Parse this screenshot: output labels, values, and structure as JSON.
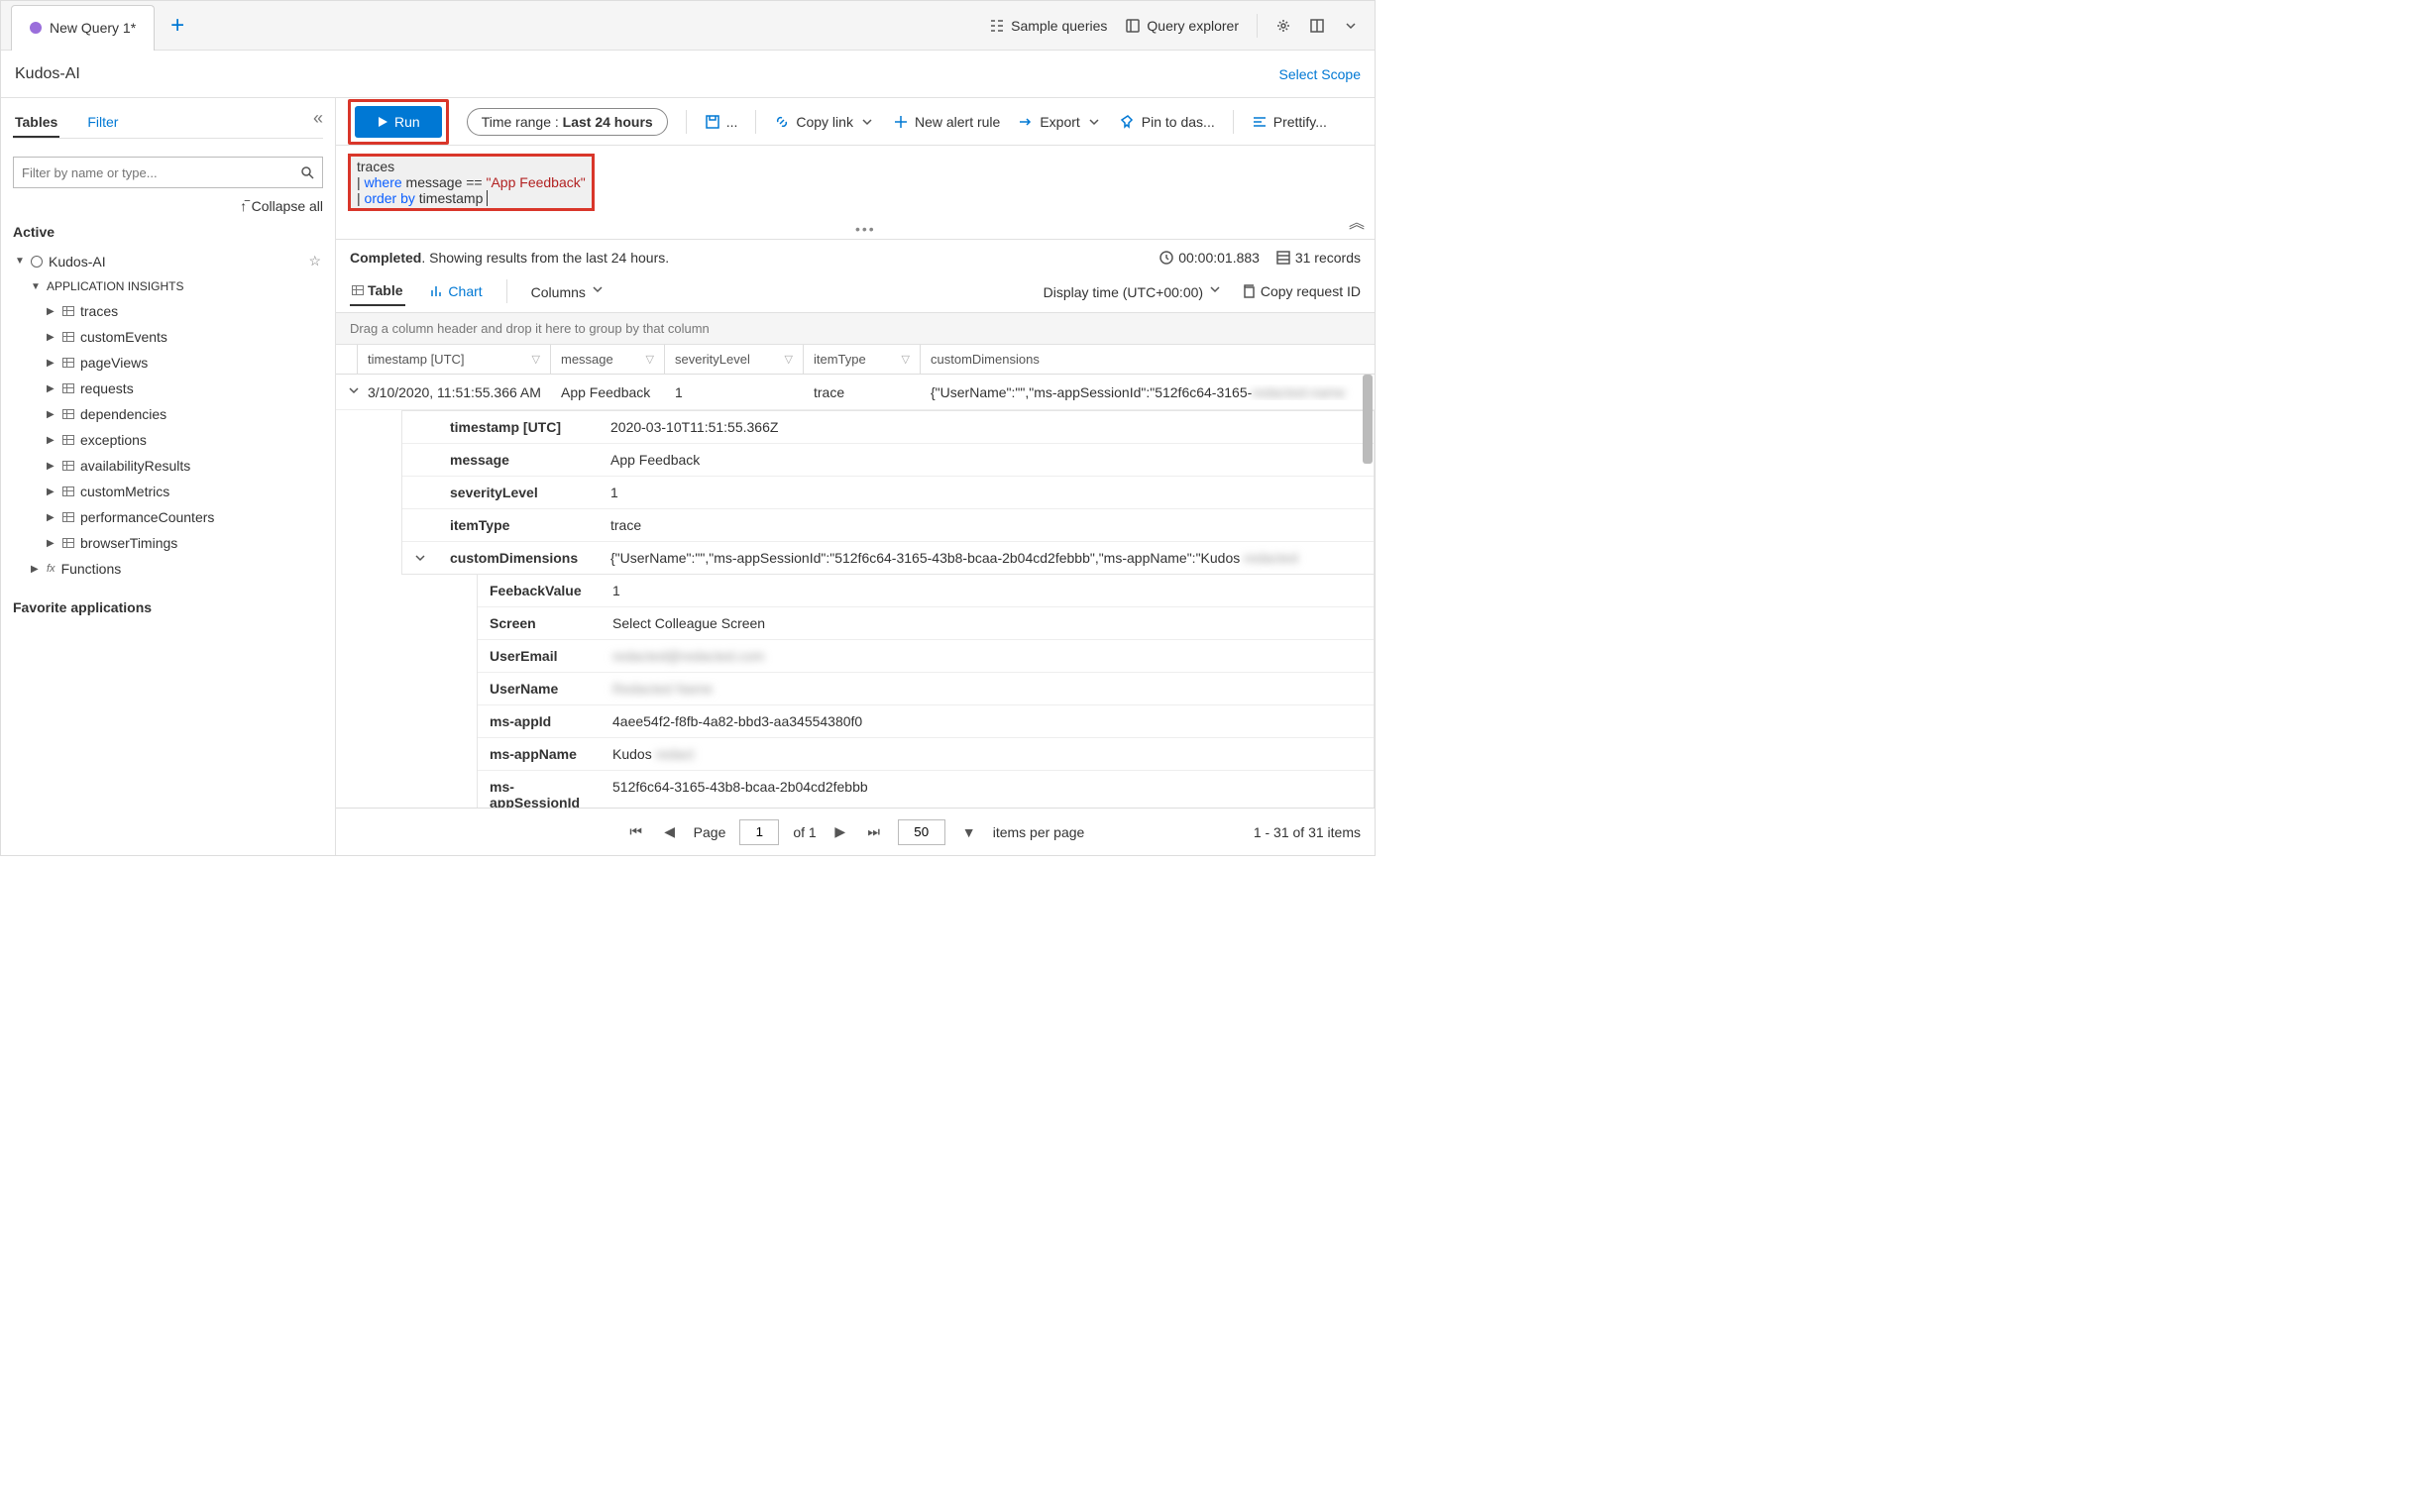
{
  "tab": {
    "title": "New Query 1*"
  },
  "topbar": {
    "sample_queries": "Sample queries",
    "query_explorer": "Query explorer"
  },
  "scope": {
    "name": "Kudos-AI",
    "select_scope": "Select Scope"
  },
  "sidebar": {
    "tabs": {
      "tables": "Tables",
      "filter": "Filter"
    },
    "search_placeholder": "Filter by name or type...",
    "collapse_all": "Collapse all",
    "active_heading": "Active",
    "root": "Kudos-AI",
    "group": "APPLICATION INSIGHTS",
    "items": [
      "traces",
      "customEvents",
      "pageViews",
      "requests",
      "dependencies",
      "exceptions",
      "availabilityResults",
      "customMetrics",
      "performanceCounters",
      "browserTimings"
    ],
    "functions": "Functions",
    "favorites_heading": "Favorite applications"
  },
  "toolbar": {
    "run": "Run",
    "time_range_prefix": "Time range : ",
    "time_range_value": "Last 24 hours",
    "save_more": "...",
    "copy_link": "Copy link",
    "new_alert": "New alert rule",
    "export": "Export",
    "pin": "Pin to das...",
    "prettify": "Prettify..."
  },
  "query": {
    "line1": "traces",
    "line2_pipe": "| ",
    "line2_kw": "where",
    "line2_field": " message == ",
    "line2_str": "\"App Feedback\"",
    "line3_pipe": "| ",
    "line3_kw": "order by",
    "line3_field": " timestamp"
  },
  "status": {
    "completed": "Completed",
    "showing": ". Showing results from the last 24 hours.",
    "elapsed": "00:00:01.883",
    "records": "31 records"
  },
  "views": {
    "table": "Table",
    "chart": "Chart",
    "columns": "Columns",
    "display_time": "Display time (UTC+00:00)",
    "copy_request": "Copy request ID"
  },
  "group_hint": "Drag a column header and drop it here to group by that column",
  "columns": {
    "timestamp": "timestamp [UTC]",
    "message": "message",
    "severity": "severityLevel",
    "itemType": "itemType",
    "customDimensions": "customDimensions"
  },
  "row": {
    "timestamp_display": "3/10/2020, 11:51:55.366 AM",
    "message": "App Feedback",
    "severity": "1",
    "itemType": "trace",
    "customDimensions_preview": "{\"UserName\":\"\",\"ms-appSessionId\":\"512f6c64-3165-"
  },
  "details": {
    "timestamp_key": "timestamp [UTC]",
    "timestamp_val": "2020-03-10T11:51:55.366Z",
    "message_key": "message",
    "message_val": "App Feedback",
    "severity_key": "severityLevel",
    "severity_val": "1",
    "itemType_key": "itemType",
    "itemType_val": "trace",
    "cd_key": "customDimensions",
    "cd_val": "{\"UserName\":\"\",\"ms-appSessionId\":\"512f6c64-3165-43b8-bcaa-2b04cd2febbb\",\"ms-appName\":\"Kudos"
  },
  "nested": {
    "FeebackValue": "1",
    "Screen": "Select Colleague Screen",
    "UserEmail": "",
    "UserName": "",
    "ms-appId": "4aee54f2-f8fb-4a82-bbd3-aa34554380f0",
    "ms-appName": "Kudos",
    "ms-appSessionId": "512f6c64-3165-43b8-bcaa-2b04cd2febbb"
  },
  "pager": {
    "page": "Page",
    "page_num": "1",
    "of": "of 1",
    "size": "50",
    "items_per_page": "items per page",
    "summary": "1 - 31 of 31 items"
  }
}
